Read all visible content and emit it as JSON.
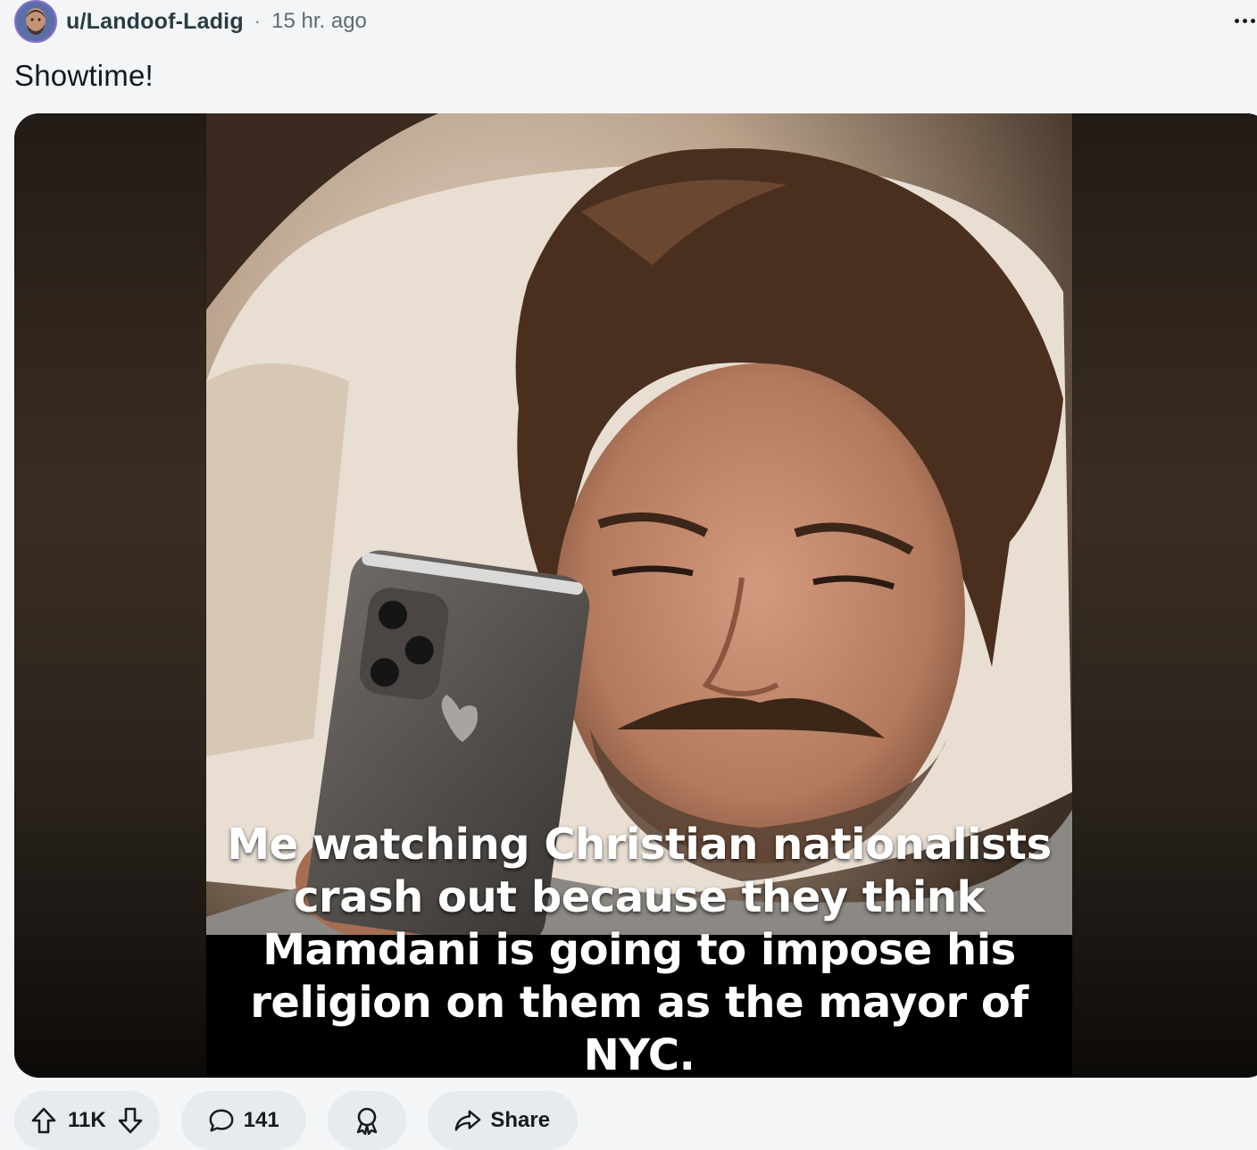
{
  "post": {
    "author": "u/Landoof-Ladig",
    "separator": "·",
    "time": "15 hr. ago",
    "title": "Showtime!",
    "more_icon": "more-horizontal-icon"
  },
  "meme": {
    "caption": "Me watching Christian nationalists crash out because they think Mamdani is going to impose his religion on them as the mayor of NYC."
  },
  "actions": {
    "score": "11K",
    "comments": "141",
    "share_label": "Share"
  },
  "icons": {
    "upvote": "arrow-up-icon",
    "downvote": "arrow-down-icon",
    "comment": "speech-bubble-icon",
    "award": "award-ribbon-icon",
    "share": "share-arrow-icon"
  }
}
